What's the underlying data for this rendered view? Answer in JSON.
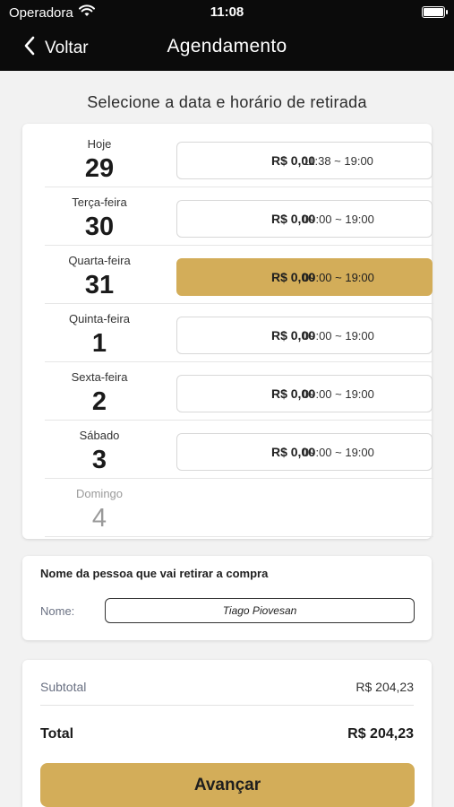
{
  "status_bar": {
    "carrier": "Operadora",
    "time": "11:08"
  },
  "nav": {
    "back_label": "Voltar",
    "title": "Agendamento"
  },
  "heading": "Selecione a data e horário de retirada",
  "days": [
    {
      "label": "Hoje",
      "number": "29",
      "price": "R$ 0,00",
      "hours": "11:38 ~ 19:00",
      "selected": false,
      "available": true
    },
    {
      "label": "Terça-feira",
      "number": "30",
      "price": "R$ 0,00",
      "hours": "09:00 ~ 19:00",
      "selected": false,
      "available": true
    },
    {
      "label": "Quarta-feira",
      "number": "31",
      "price": "R$ 0,00",
      "hours": "09:00 ~ 19:00",
      "selected": true,
      "available": true
    },
    {
      "label": "Quinta-feira",
      "number": "1",
      "price": "R$ 0,00",
      "hours": "09:00 ~ 19:00",
      "selected": false,
      "available": true
    },
    {
      "label": "Sexta-feira",
      "number": "2",
      "price": "R$ 0,00",
      "hours": "09:00 ~ 19:00",
      "selected": false,
      "available": true
    },
    {
      "label": "Sábado",
      "number": "3",
      "price": "R$ 0,00",
      "hours": "09:00 ~ 19:00",
      "selected": false,
      "available": true
    },
    {
      "label": "Domingo",
      "number": "4",
      "available": false
    }
  ],
  "pickup": {
    "title": "Nome da pessoa que vai retirar a compra",
    "name_label": "Nome:",
    "name_value": "Tiago Piovesan"
  },
  "summary": {
    "subtotal_label": "Subtotal",
    "subtotal_value": "R$ 204,23",
    "total_label": "Total",
    "total_value": "R$ 204,23",
    "next_label": "Avançar"
  },
  "colors": {
    "accent": "#d3ad59",
    "header_bg": "#0b0b0b",
    "background": "#f2f2f2"
  },
  "icons": {
    "back": "chevron-left-icon",
    "wifi": "wifi-icon",
    "battery": "battery-icon"
  }
}
